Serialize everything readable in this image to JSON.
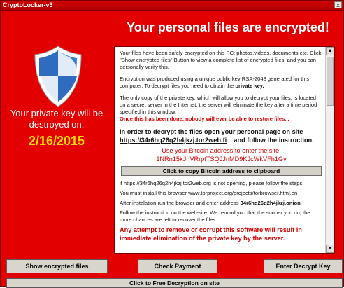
{
  "window": {
    "title": "CryptoLocker-v3",
    "close_glyph": "x"
  },
  "headline": "Your personal files are encrypted!",
  "left": {
    "private_key_text": "Your private key will be destroyed on:",
    "deadline": "2/16/2015",
    "icon": "shield-icon"
  },
  "panel": {
    "p1": "Your files have been safely encrypted on this PC: photos,videos, documents,etc. Click \"Show encrypted files\" Button to view a complete list of encrypted files, and you can personally verify this.",
    "p2_a": "Encryption was produced using a unique public key RSA-2048 generated for this computer. To decrypt files you need to obtain the ",
    "p2_b": "private key.",
    "p3": "The only copy of the private key, which will allow you to decrypt your files, is located on a secret server in the Internet; the server will eliminate the key after a time period specified in this window.",
    "p4": "Once this has been done, nobody will ever be able to restore files...",
    "p5_a": "In order to decrypt the files open your personal page on site",
    "p5_link": "https://34r6hq26q2h4jkzj.tor2web.fi",
    "p5_b": "and follow the instruction.",
    "bitcoin_label": "Use your Bitcoin address to  enter the site:",
    "bitcoin_address": "1NRn15kJnVRrptTSQJJnMD9KJcWkVFh1Gv",
    "copy_button": "Click to copy Bitcoin address to clipboard",
    "p6": "if https://34r6hq26q2h4jkzj.tor2web.org is not opening, please follow the steps:",
    "p7_a": "You must install this browser ",
    "p7_link": "www.torproject.org/projects/torbrowser.html.en",
    "p8_a": "After instalation,run the browser and enter address ",
    "p8_b": "34r6hq26q2h4jkzj.onion",
    "p9": "Follow the instruction on the web-site. We remind you that the  sooner you do, the more chances are left to recover the files.",
    "p10": "Any attempt to remove or corrupt this software will result in immediate elimination of the private key by the server."
  },
  "buttons": {
    "show": "Show encrypted files",
    "pay": "Check Payment",
    "decrypt": "Enter Decrypt Key",
    "free": "Click to Free Decryption on site"
  },
  "colors": {
    "background": "#e30000",
    "deadline": "#ffdc00",
    "warning_text": "#d40000"
  }
}
